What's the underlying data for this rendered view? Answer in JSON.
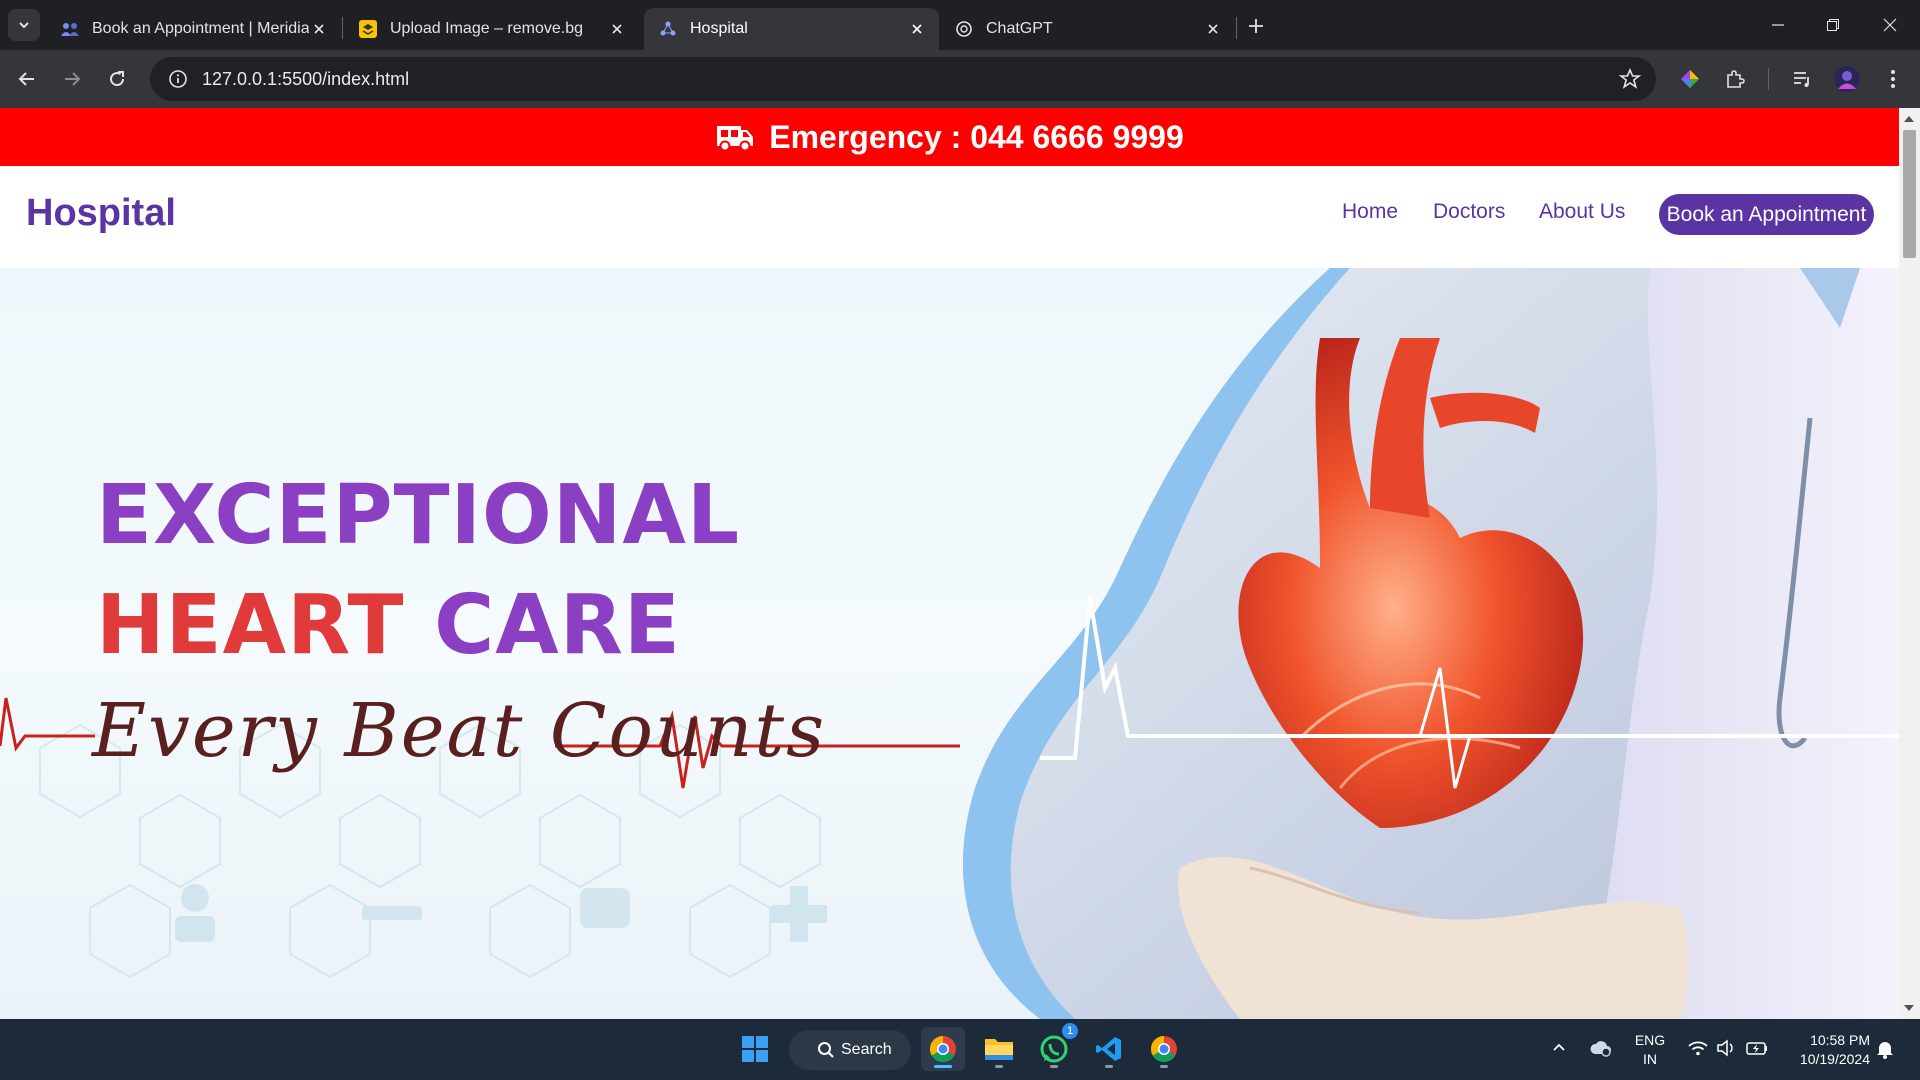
{
  "browser": {
    "tabs": [
      {
        "title": "Book an Appointment | Meridia",
        "favicon": "people-icon",
        "active": false
      },
      {
        "title": "Upload Image – remove.bg",
        "favicon": "removebg-icon",
        "active": false
      },
      {
        "title": "Hospital",
        "favicon": "hospital-icon",
        "active": true
      },
      {
        "title": "ChatGPT",
        "favicon": "chatgpt-icon",
        "active": false
      }
    ],
    "url": "127.0.0.1:5500/index.html"
  },
  "page": {
    "emergency": {
      "text": "Emergency : 044 6666 9999",
      "background": "#ff0000"
    },
    "brand": "Hospital",
    "nav": {
      "home": "Home",
      "doctors": "Doctors",
      "about": "About Us",
      "cta": "Book an Appointment"
    },
    "accent": "#5b34a4",
    "hero": {
      "line1": "EXCEPTIONAL",
      "line2_red": "HEART",
      "line2_purple": "CARE",
      "tagline": "Every Beat Counts",
      "colors": {
        "purple": "#8b3fc2",
        "red": "#e03a3a"
      }
    }
  },
  "taskbar": {
    "search_label": "Search",
    "whatsapp_badge": "1",
    "language": "ENG",
    "region": "IN",
    "time": "10:58 PM",
    "date": "10/19/2024"
  }
}
